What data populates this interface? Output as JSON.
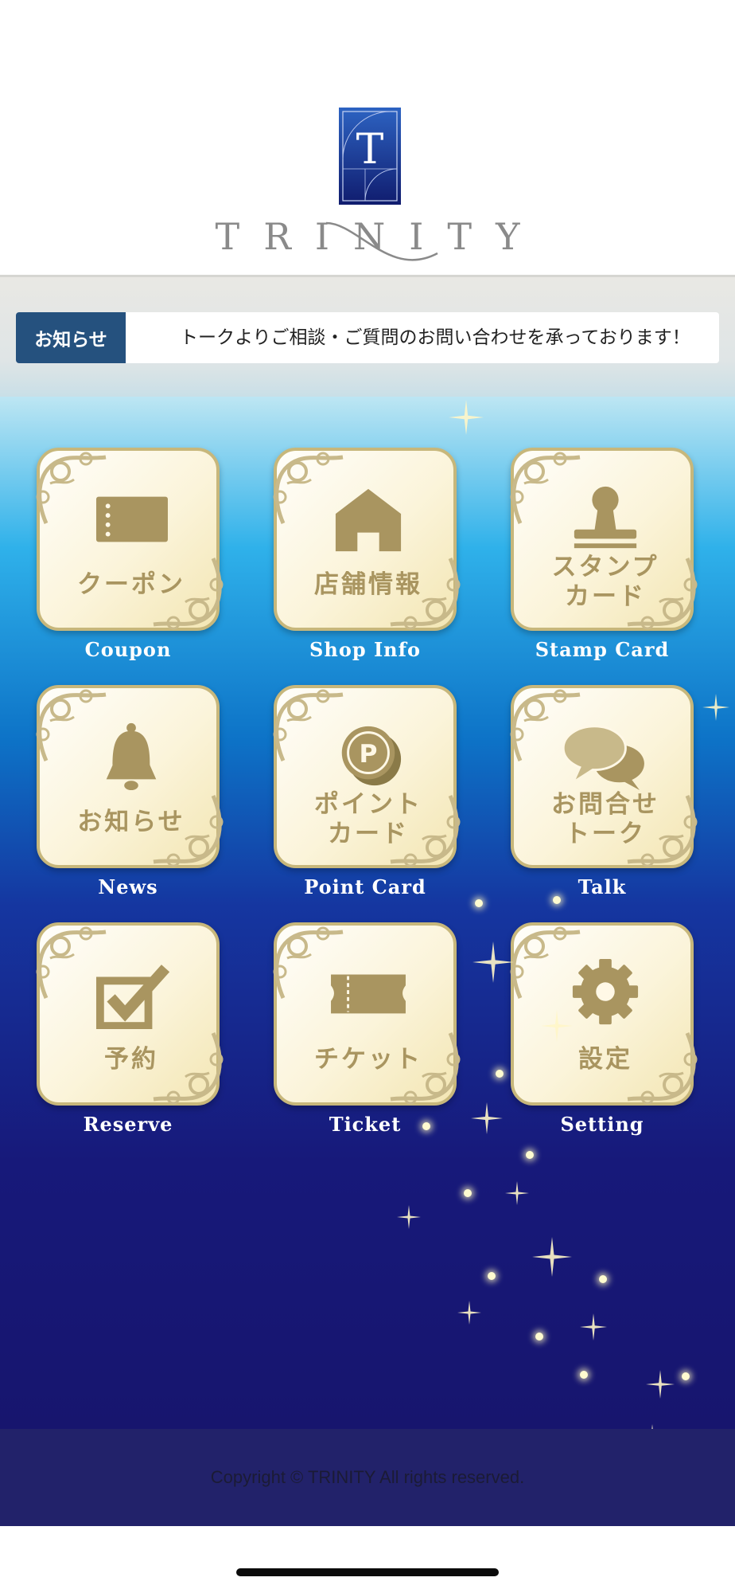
{
  "brand": {
    "name": "TRINITY",
    "logo_letter": "T"
  },
  "news": {
    "label": "お知らせ",
    "message": "トークよりご相談・ご質問のお問い合わせを承っております！"
  },
  "menu": [
    {
      "jp": [
        "クーポン"
      ],
      "en": "Coupon",
      "icon": "coupon-icon"
    },
    {
      "jp": [
        "店舗情報"
      ],
      "en": "Shop Info",
      "icon": "shop-icon"
    },
    {
      "jp": [
        "スタンプ",
        "カード"
      ],
      "en": "Stamp Card",
      "icon": "stamp-icon"
    },
    {
      "jp": [
        "お知らせ"
      ],
      "en": "News",
      "icon": "bell-icon"
    },
    {
      "jp": [
        "ポイント",
        "カード"
      ],
      "en": "Point Card",
      "icon": "point-coin-icon",
      "icon_letter": "P"
    },
    {
      "jp": [
        "お問合せ",
        "トーク"
      ],
      "en": "Talk",
      "icon": "chat-bubbles-icon"
    },
    {
      "jp": [
        "予約"
      ],
      "en": "Reserve",
      "icon": "checkbox-icon"
    },
    {
      "jp": [
        "チケット"
      ],
      "en": "Ticket",
      "icon": "ticket-icon"
    },
    {
      "jp": [
        "設定"
      ],
      "en": "Setting",
      "icon": "gear-icon"
    }
  ],
  "footer": {
    "copyright": "Copyright © TRINITY All rights reserved."
  },
  "colors": {
    "gold": "#a99560",
    "news_label_bg": "#25517e",
    "logo_blue": "#1b3a8f"
  }
}
